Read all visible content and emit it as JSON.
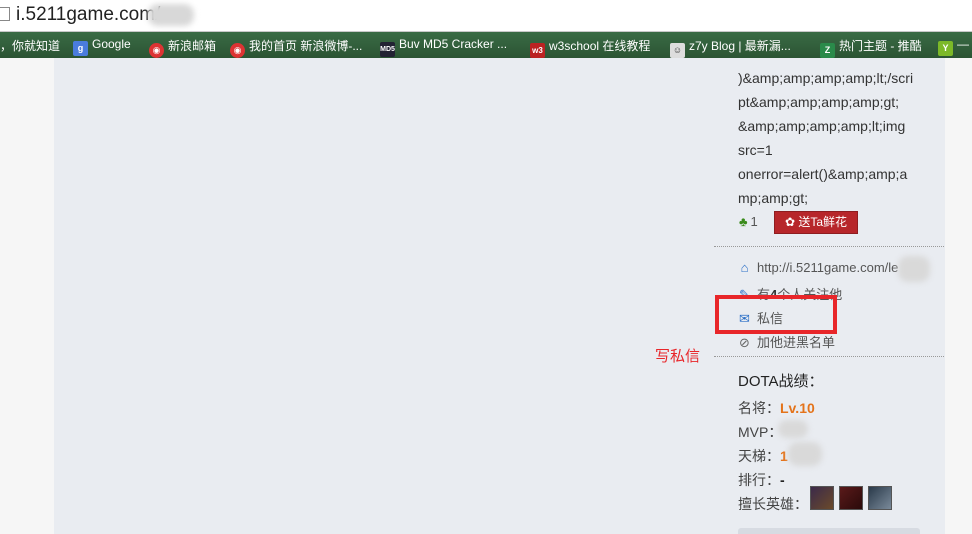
{
  "browser": {
    "url": "i.5211game.com/",
    "bookmarks": [
      {
        "label": "，你就知道",
        "icon": "baidu-icon"
      },
      {
        "label": "Google",
        "icon": "google-icon"
      },
      {
        "label": "新浪邮箱",
        "icon": "weibo-icon"
      },
      {
        "label": "我的首页 新浪微博-...",
        "icon": "weibo-icon"
      },
      {
        "label": "Buv MD5 Cracker ...",
        "icon": "md5-icon"
      },
      {
        "label": "w3school 在线教程",
        "icon": "w3-icon"
      },
      {
        "label": "z7y Blog | 最新漏...",
        "icon": "z7y-icon"
      },
      {
        "label": "热门主题 - 推酷",
        "icon": "tuicool-icon"
      },
      {
        "label": "—",
        "icon": "y-icon"
      }
    ]
  },
  "post": {
    "code_lines": [
      ")&amp;amp;amp;amp;lt;/scri",
      "pt&amp;amp;amp;amp;gt;",
      "&amp;amp;amp;amp;lt;img",
      "src=1",
      "onerror=alert()&amp;amp;a",
      "mp;amp;gt;"
    ],
    "like_count": "1",
    "flower_button": "送Ta鲜花"
  },
  "profile": {
    "homepage": "http://i.5211game.com/le",
    "followers_prefix": "有",
    "followers_count": "4",
    "followers_suffix": "个人关注他",
    "message_label": "私信",
    "blacklist_label": "加他进黑名单"
  },
  "annotation": "写私信",
  "dota": {
    "title": "DOTA战绩：",
    "rank_label": "名将：",
    "rank_value": "Lv.10",
    "mvp_label": "MVP：",
    "ladder_label": "天梯：",
    "ladder_value": "1",
    "position_label": "排行：",
    "position_value": "-",
    "heroes_label": "擅长英雄：",
    "heroes": [
      "hero-1",
      "hero-2",
      "hero-3"
    ]
  },
  "colors": {
    "accent_red": "#e8262a",
    "flower_red": "#b7262a",
    "orange": "#e4731a",
    "bookmark_bar": "#2f5a38"
  }
}
